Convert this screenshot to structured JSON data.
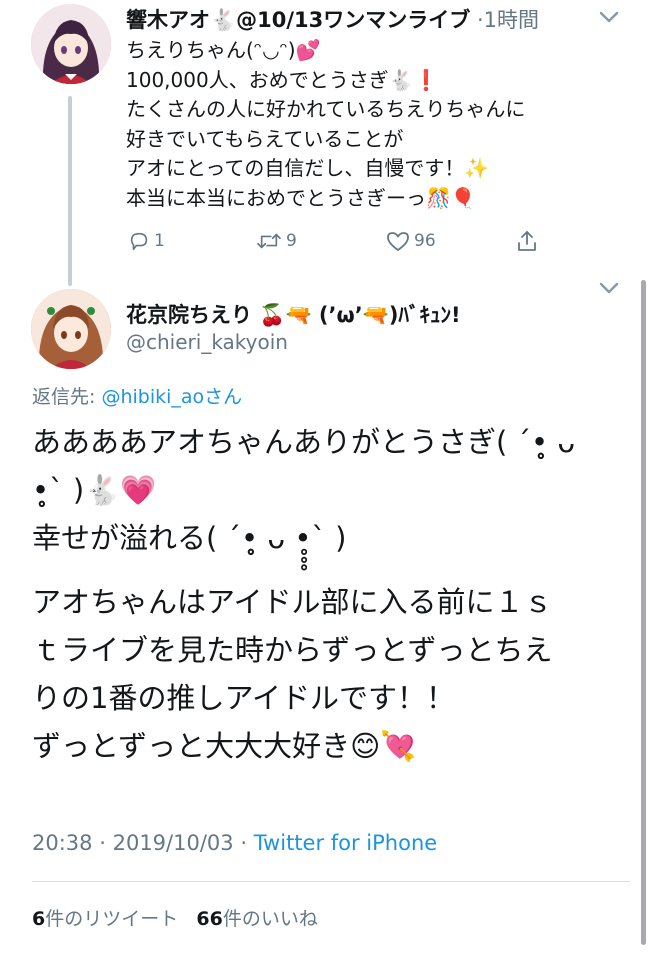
{
  "parent_tweet": {
    "display_name": "響木アオ",
    "name_emoji": "🐇",
    "name_suffix": "@10/13ワンマンライブ",
    "separator": "·",
    "time": "1時間",
    "lines": [
      "ちえりちゃん(ᵔ◡ᵔ)",
      "100,000人、おめでとうさぎ",
      "たくさんの人に好かれているちえりちゃんに",
      "好きでいてもらえていることが",
      "アオにとっての自信だし、自慢です！",
      "本当に本当におめでとうさぎーっ"
    ],
    "line_emojis": [
      "💕",
      "🐇❗",
      "",
      "",
      "✨",
      "🎊🎈"
    ],
    "actions": {
      "reply_count": "1",
      "retweet_count": "9",
      "like_count": "96"
    }
  },
  "main_tweet": {
    "display_name": "花京院ちえり",
    "name_emoji": "🍒🔫",
    "name_suffix": "(’ω’",
    "name_emoji2": "🔫",
    "name_tail": ")ﾊﾞｷｭﾝ!",
    "handle": "@chieri_kakyoin",
    "reply_prefix": "返信先:",
    "reply_handle": "@hibiki_ao",
    "reply_suffix": "さん",
    "paragraph1": [
      "ああああアオちゃんありがとうさぎ( ´•̥̥̥ ᴗ",
      "•̥̥̥` )",
      "幸せが溢れる( ´•̥̥̥ ᴗ •̥̥̥` )"
    ],
    "paragraph1_emojis": [
      "",
      "🐇💗",
      ""
    ],
    "paragraph2": [
      "アオちゃんはアイドル部に入る前に１ｓ",
      "ｔライブを見た時からずっとずっとちえ",
      "りの1番の推しアイドルです！！",
      "ずっとずっと大大大好き"
    ],
    "paragraph2_end_emoji": "😊💘",
    "time": "20:38",
    "date": "2019/10/03",
    "meta_separator": "·",
    "source": "Twitter for iPhone",
    "retweets_count": "6",
    "retweets_label": "件のリツイート",
    "likes_count": "66",
    "likes_label": "件のいいね"
  },
  "colors": {
    "link": "#1b95e0",
    "muted": "#657786",
    "text": "#14171a"
  },
  "icons": [
    "chevron-down-icon",
    "reply-icon",
    "retweet-icon",
    "heart-icon",
    "share-icon"
  ]
}
